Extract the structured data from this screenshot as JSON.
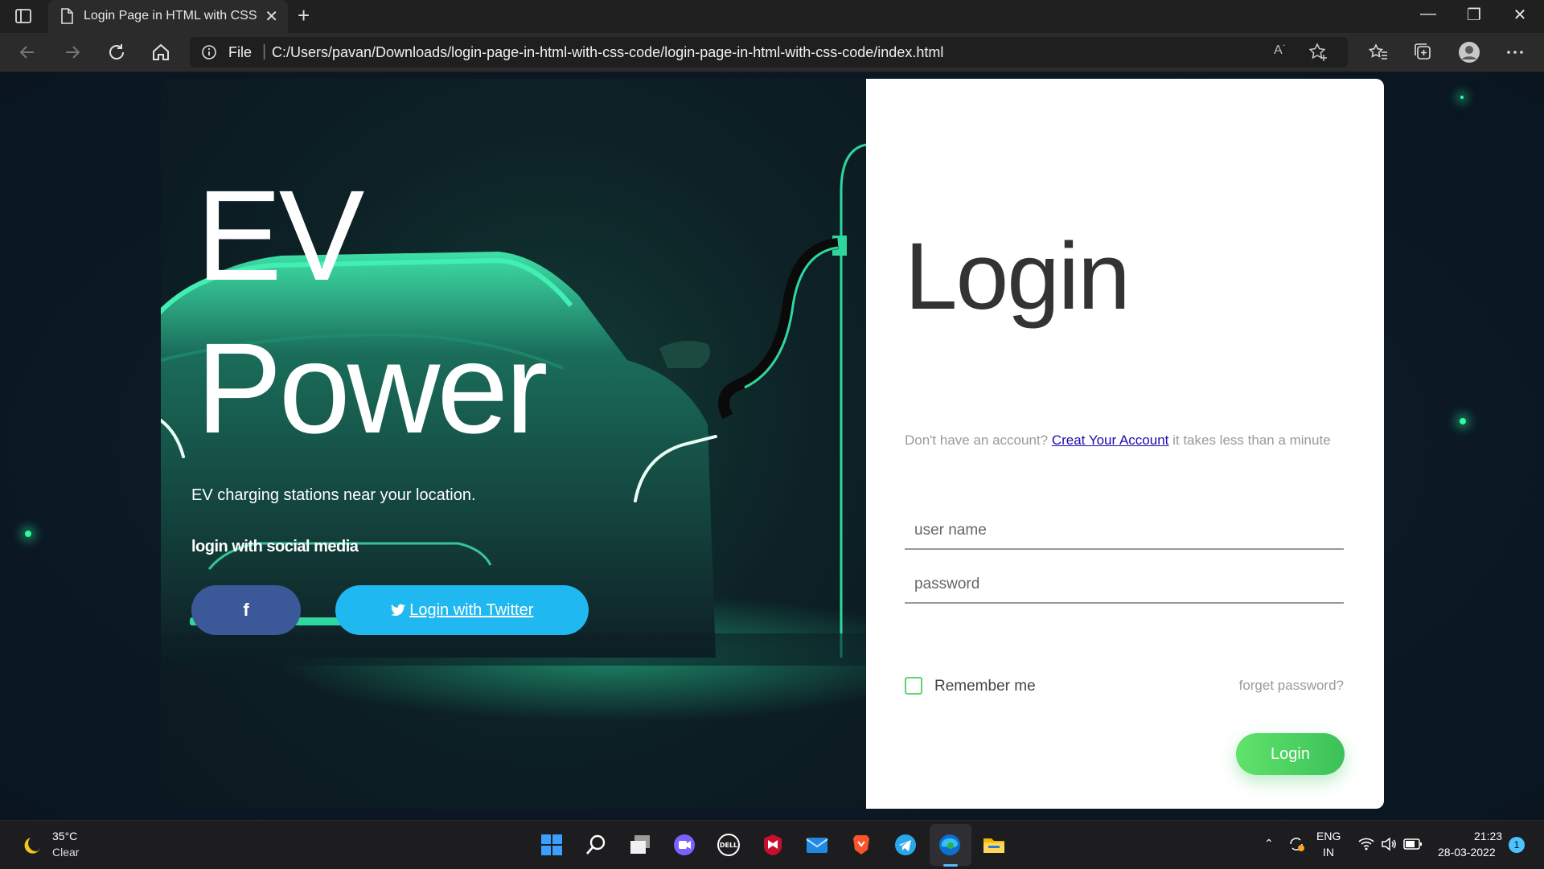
{
  "browser": {
    "tab_title": "Login Page in HTML with CSS Co",
    "tab_close": "✕",
    "new_tab": "+",
    "address_label": "File",
    "url": "C:/Users/pavan/Downloads/login-page-in-html-with-css-code/login-page-in-html-with-css-code/index.html",
    "win_minimize": "—",
    "win_restore": "❐",
    "win_close": "✕"
  },
  "hero": {
    "title_line1": "EV",
    "title_line2": "Power",
    "subtitle": "EV charging stations near your location.",
    "social_label": "login with social media",
    "facebook_label": "f",
    "twitter_label": "Login with Twitter"
  },
  "login": {
    "heading": "Login",
    "signup_prefix": "Don't have an account? ",
    "signup_link": "Creat Your Account",
    "signup_suffix": " it takes less than a minute",
    "username_placeholder": "user name",
    "password_placeholder": "password",
    "remember_label": "Remember me",
    "forgot_label": "forget password?",
    "submit_label": "Login"
  },
  "taskbar": {
    "temperature": "35°C",
    "weather": "Clear",
    "lang_line1": "ENG",
    "lang_line2": "IN",
    "time": "21:23",
    "date": "28-03-2022",
    "notification_count": "1"
  },
  "colors": {
    "accent_green": "#3cc15a",
    "facebook": "#3b5998",
    "twitter": "#1fb8f0",
    "neon": "#2dfca1"
  }
}
